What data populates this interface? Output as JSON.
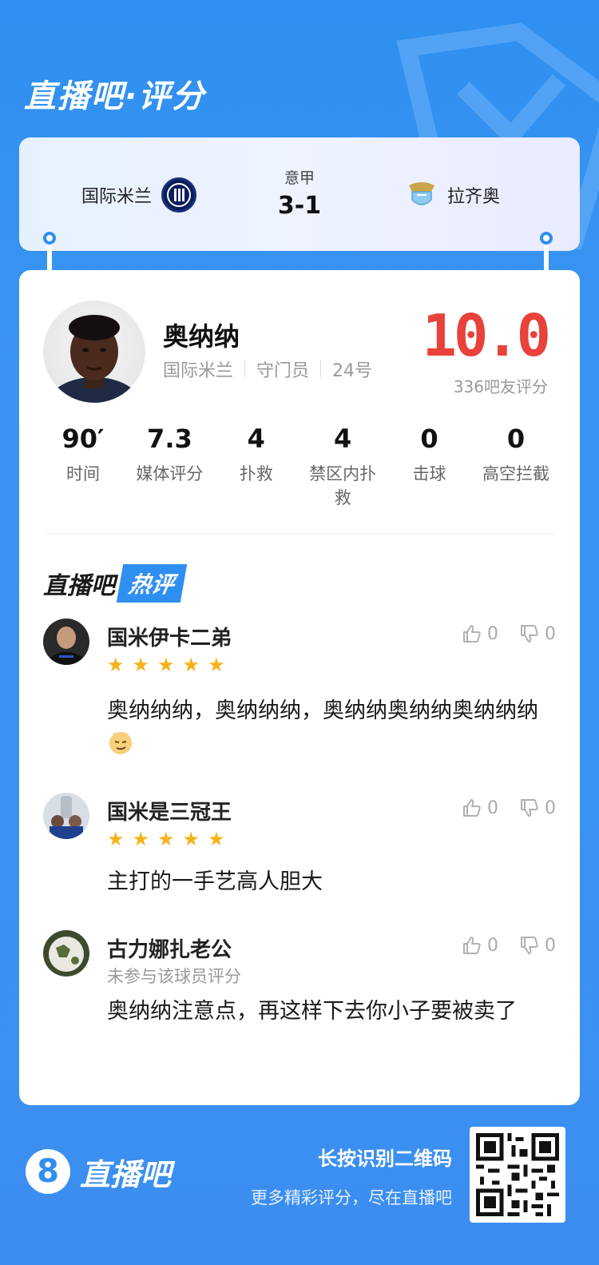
{
  "header": {
    "title": "直播吧·评分"
  },
  "match": {
    "home_team": "国际米兰",
    "away_team": "拉齐奥",
    "league": "意甲",
    "score": "3-1"
  },
  "player": {
    "name": "奥纳纳",
    "team": "国际米兰",
    "position": "守门员",
    "number": "24号",
    "rating": "10.0",
    "rating_count": "336吧友评分"
  },
  "stats": [
    {
      "value": "90′",
      "label": "时间"
    },
    {
      "value": "7.3",
      "label": "媒体评分"
    },
    {
      "value": "4",
      "label": "扑救"
    },
    {
      "value": "4",
      "label": "禁区内扑救"
    },
    {
      "value": "0",
      "label": "击球"
    },
    {
      "value": "0",
      "label": "高空拦截"
    }
  ],
  "hot_section": {
    "brand": "直播吧",
    "tag": "热评"
  },
  "comments": [
    {
      "user": "国米伊卡二弟",
      "stars": 5,
      "text": "奥纳纳纳，奥纳纳纳，奥纳纳奥纳纳奥纳纳纳",
      "likes": "0",
      "dislikes": "0"
    },
    {
      "user": "国米是三冠王",
      "stars": 5,
      "text": "主打的一手艺高人胆大",
      "likes": "0",
      "dislikes": "0"
    },
    {
      "user": "古力娜扎老公",
      "note": "未参与该球员评分",
      "text": "奥纳纳注意点，再这样下去你小子要被卖了",
      "likes": "0",
      "dislikes": "0"
    }
  ],
  "footer": {
    "logo_mark": "8",
    "logo_text": "直播吧",
    "cta_title": "长按识别二维码",
    "cta_sub": "更多精彩评分，尽在直播吧"
  },
  "colors": {
    "brand_blue": "#2f8ff0",
    "rating_red": "#e8423a",
    "star_gold": "#f6b21b"
  }
}
